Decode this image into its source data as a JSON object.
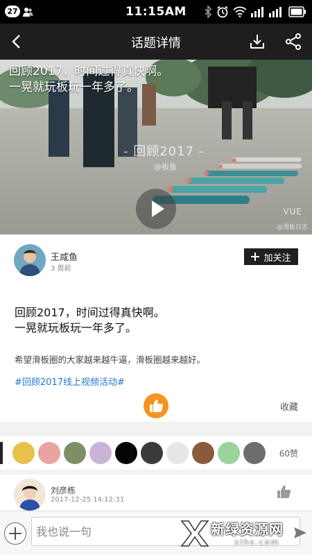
{
  "status_bar": {
    "notification_count": "27",
    "time": "11:15AM",
    "icons": [
      "user-icon",
      "bluetooth-icon",
      "alarm-icon",
      "wifi-icon",
      "signal-icon",
      "battery-icon"
    ]
  },
  "title_bar": {
    "title": "话题详情",
    "back_icon": "back-arrow-icon",
    "download_icon": "download-icon",
    "share_icon": "share-icon"
  },
  "video": {
    "caption": "回顾2017，时间过得真快啊。\n一晃就玩板玩一年多了。",
    "watermark": "- 回顾2017 -",
    "watermark_sub": "@板鱼",
    "corner_mark": "VUE",
    "corner_sub": "@滑板日志",
    "play_icon": "play-icon"
  },
  "post": {
    "author": "王咸鱼",
    "time": "3 周前",
    "follow_label": "加关注",
    "title": "回顾2017，时间过得真快啊。\n一晃就玩板玩一年多了。",
    "body": "希望滑板圈的大家越来越牛逼，滑板圈越来越好。",
    "tag": "#回顾2017线上视频活动#",
    "collect_label": "收藏",
    "like_color": "#f7931e"
  },
  "likes": {
    "count_label": "60赞",
    "avatar_colors": [
      "#e8c14a",
      "#e9a3a0",
      "#7d8f66",
      "#c9b4d8",
      "#050505",
      "#3a3a3a",
      "#e6e6e6",
      "#8a5a3c",
      "#9bd39b",
      "#6d6d6d"
    ]
  },
  "comment": {
    "author": "刘彦栋",
    "time": "2017-12-25 14:12:31"
  },
  "input_bar": {
    "placeholder": "我也说一句"
  },
  "site_watermark": {
    "name": "新绿资源网",
    "url": "xlhs.com"
  }
}
